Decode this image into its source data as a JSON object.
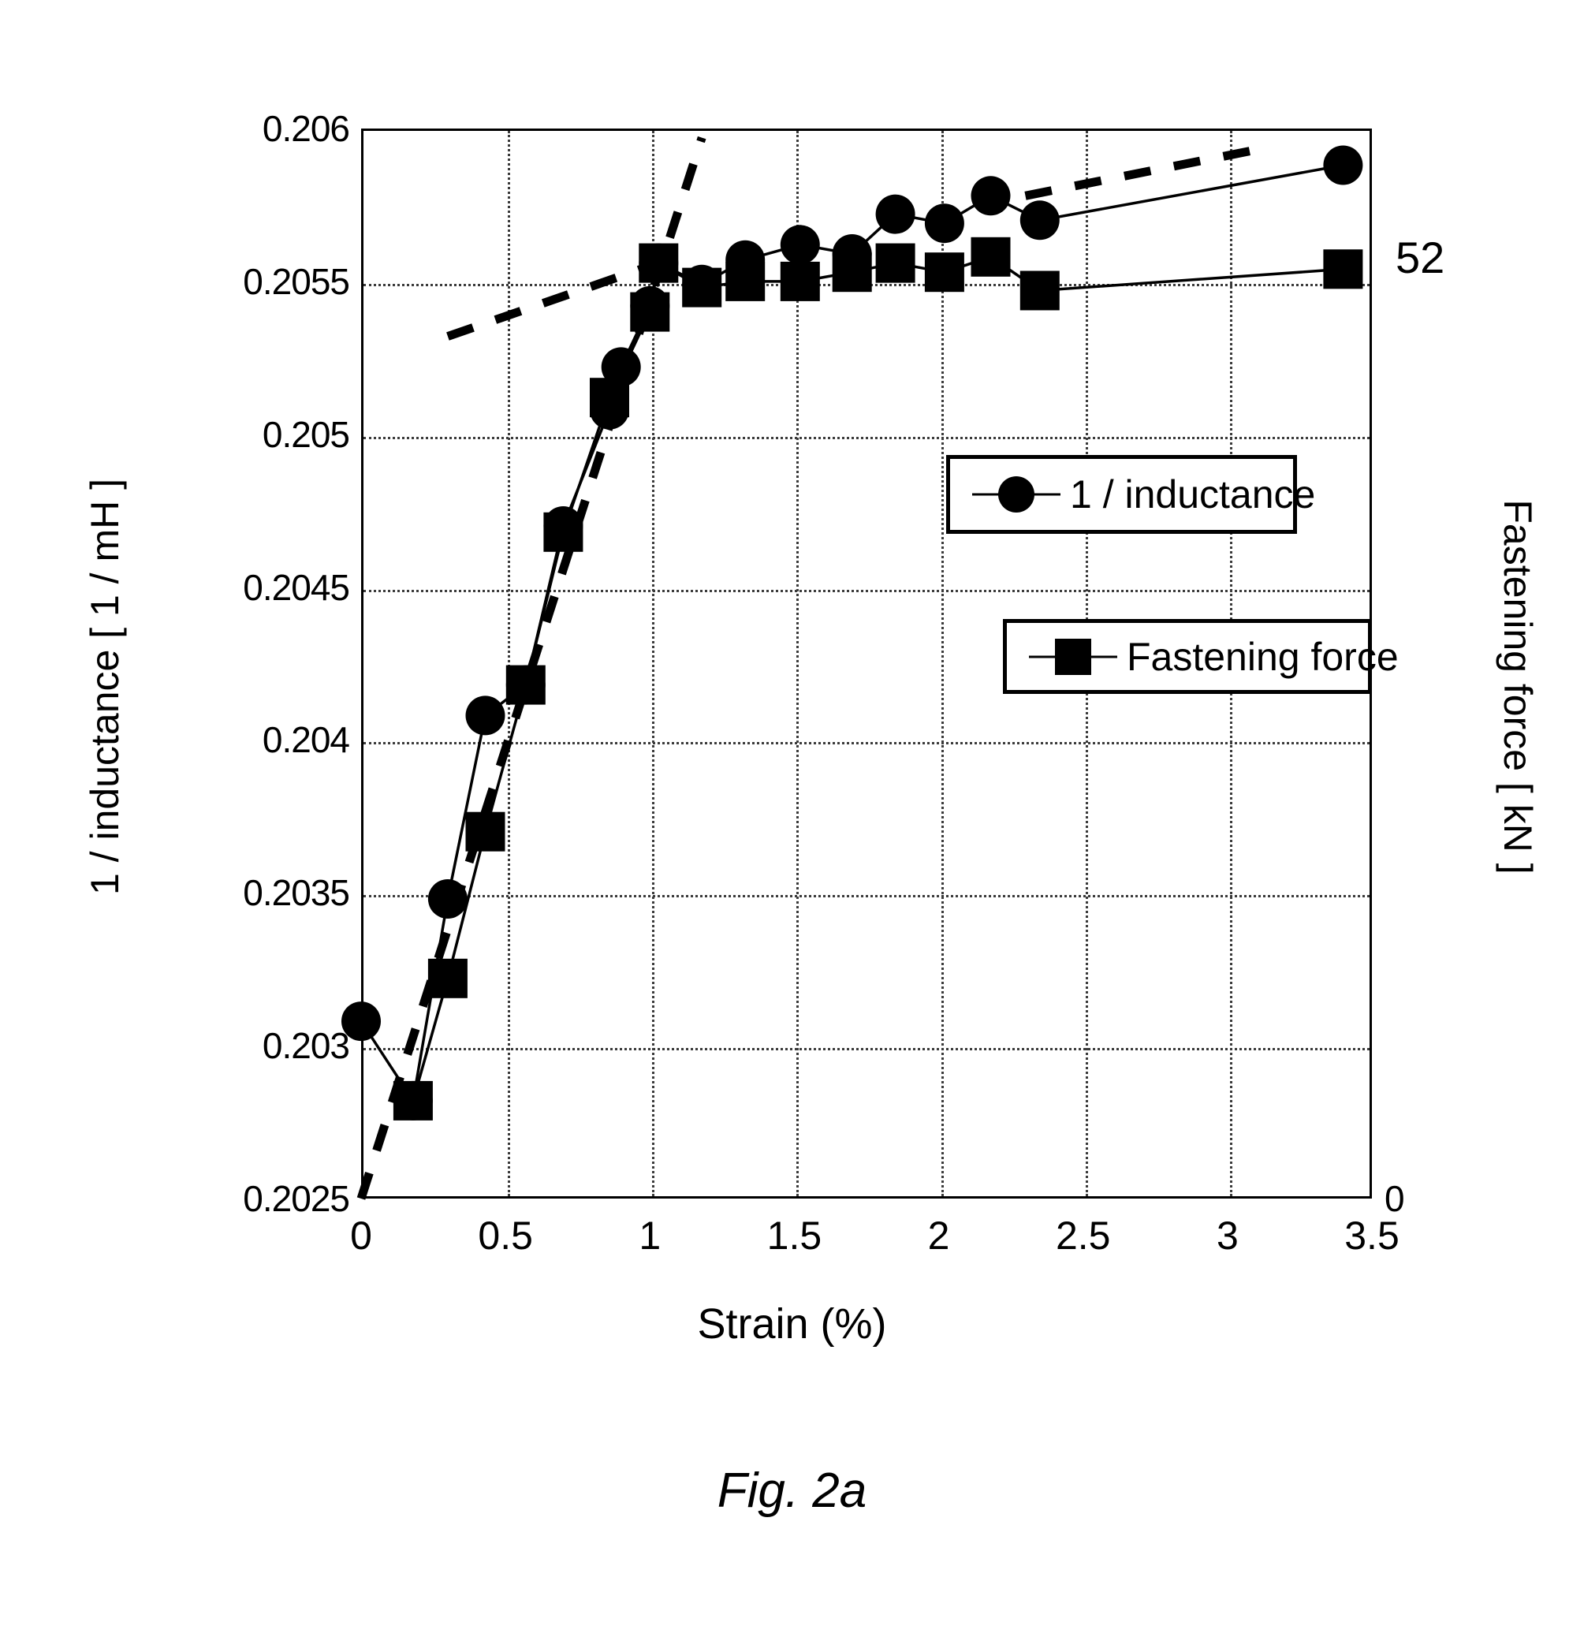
{
  "figure": {
    "caption": "Fig. 2a",
    "right_annotation": "52"
  },
  "axes": {
    "x_title": "Strain (%)",
    "y_left_title": "1 / inductance [ 1 / mH ]",
    "y_right_title": "Fastening force [ kN ]",
    "x_ticks": [
      "0",
      "0.5",
      "1",
      "1.5",
      "2",
      "2.5",
      "3",
      "3.5"
    ],
    "y_left_ticks": [
      "0.206",
      "0.2055",
      "0.205",
      "0.2045",
      "0.204",
      "0.2035",
      "0.203",
      "0.2025"
    ],
    "y_right_ticks": [
      "52",
      "0"
    ]
  },
  "legend": {
    "inductance_label": "1 / inductance",
    "force_label": "Fastening force"
  },
  "chart_data": {
    "type": "line",
    "title": "Fig. 2a",
    "xlabel": "Strain (%)",
    "ylabel": "1 / inductance [ 1 / mH ]",
    "y2label": "Fastening force [ kN ]",
    "xlim": [
      0,
      3.5
    ],
    "ylim": [
      0.2025,
      0.206
    ],
    "y2lim": [
      0,
      52
    ],
    "grid": true,
    "legend_position": "inside-right",
    "x_ticks": [
      0,
      0.5,
      1,
      1.5,
      2,
      2.5,
      3,
      3.5
    ],
    "y_ticks": [
      0.2025,
      0.203,
      0.2035,
      0.204,
      0.2045,
      0.205,
      0.2055,
      0.206
    ],
    "y2_ticks": [
      0,
      52
    ],
    "series": [
      {
        "name": "1 / inductance",
        "axis": "left",
        "marker": "circle",
        "points": [
          {
            "x": 0.0,
            "y": 0.20308
          },
          {
            "x": 0.18,
            "y": 0.20282
          },
          {
            "x": 0.3,
            "y": 0.20348
          },
          {
            "x": 0.43,
            "y": 0.20408
          },
          {
            "x": 0.57,
            "y": 0.20418
          },
          {
            "x": 0.7,
            "y": 0.2047
          },
          {
            "x": 0.86,
            "y": 0.20508
          },
          {
            "x": 0.9,
            "y": 0.20522
          },
          {
            "x": 1.0,
            "y": 0.20542
          },
          {
            "x": 1.03,
            "y": 0.20556
          },
          {
            "x": 1.18,
            "y": 0.20549
          },
          {
            "x": 1.33,
            "y": 0.20557
          },
          {
            "x": 1.52,
            "y": 0.20562
          },
          {
            "x": 1.7,
            "y": 0.20559
          },
          {
            "x": 1.85,
            "y": 0.20572
          },
          {
            "x": 2.02,
            "y": 0.20569
          },
          {
            "x": 2.18,
            "y": 0.20578
          },
          {
            "x": 2.35,
            "y": 0.2057
          },
          {
            "x": 3.4,
            "y": 0.20588
          }
        ]
      },
      {
        "name": "Fastening force",
        "axis": "right",
        "marker": "square",
        "points": [
          {
            "x": 0.18,
            "y": 0.20282
          },
          {
            "x": 0.3,
            "y": 0.20322
          },
          {
            "x": 0.43,
            "y": 0.2037
          },
          {
            "x": 0.57,
            "y": 0.20418
          },
          {
            "x": 0.7,
            "y": 0.20468
          },
          {
            "x": 0.86,
            "y": 0.20512
          },
          {
            "x": 1.0,
            "y": 0.2054
          },
          {
            "x": 1.03,
            "y": 0.20556
          },
          {
            "x": 1.18,
            "y": 0.20548
          },
          {
            "x": 1.33,
            "y": 0.2055
          },
          {
            "x": 1.52,
            "y": 0.2055
          },
          {
            "x": 1.7,
            "y": 0.20553
          },
          {
            "x": 1.85,
            "y": 0.20556
          },
          {
            "x": 2.02,
            "y": 0.20553
          },
          {
            "x": 2.18,
            "y": 0.20558
          },
          {
            "x": 2.35,
            "y": 0.20547
          },
          {
            "x": 3.4,
            "y": 0.20554
          }
        ]
      }
    ],
    "trend_lines": [
      {
        "name": "elastic-slope",
        "style": "dashed",
        "x0": 0.0,
        "y0": 0.2025,
        "x1": 1.18,
        "y1": 0.20597
      },
      {
        "name": "plateau-lower",
        "style": "dashed",
        "x0": 0.3,
        "y0": 0.20532,
        "x1": 1.03,
        "y1": 0.20556
      },
      {
        "name": "plateau-upper",
        "style": "dashed",
        "x0": 2.3,
        "y0": 0.20578,
        "x1": 3.15,
        "y1": 0.20594
      }
    ]
  }
}
